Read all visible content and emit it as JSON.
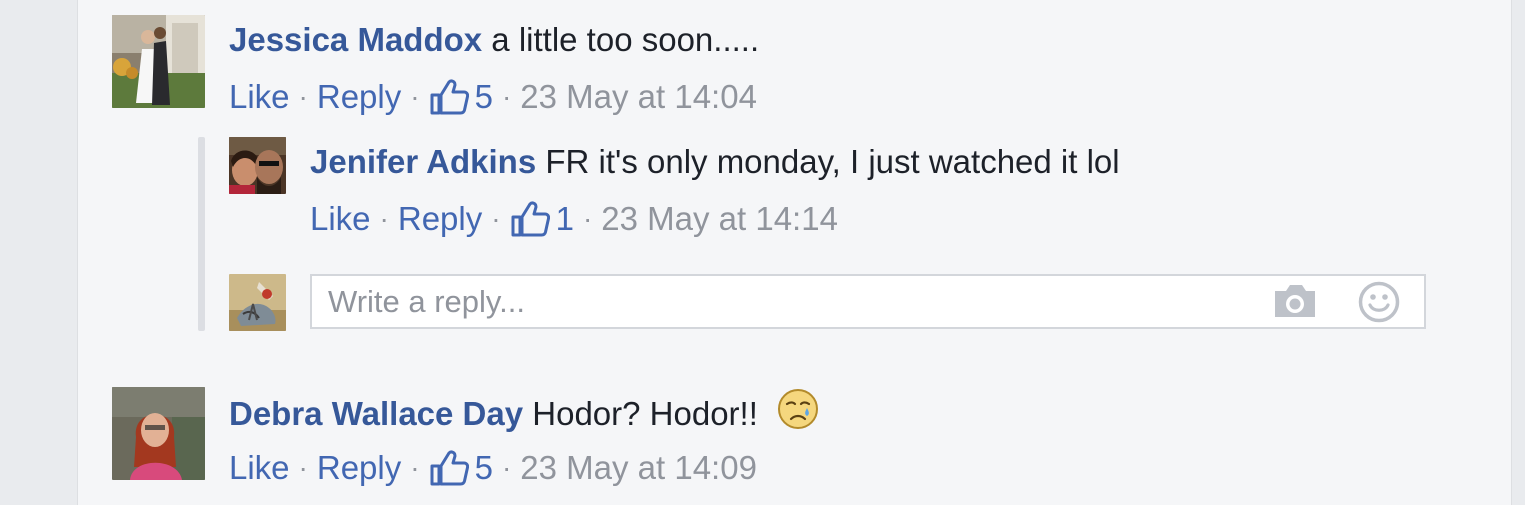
{
  "comments": [
    {
      "author": "Jessica Maddox",
      "text": "a little too soon.....",
      "like_label": "Like",
      "reply_label": "Reply",
      "like_count": "5",
      "timestamp": "23 May at 14:04",
      "replies": [
        {
          "author": "Jenifer Adkins",
          "text": "FR it's only monday, I just watched it lol",
          "like_label": "Like",
          "reply_label": "Reply",
          "like_count": "1",
          "timestamp": "23 May at 14:14"
        }
      ],
      "reply_box": {
        "placeholder": "Write a reply..."
      }
    },
    {
      "author": "Debra Wallace Day",
      "text": "Hodor? Hodor!!",
      "emoji": "crying-face",
      "like_label": "Like",
      "reply_label": "Reply",
      "like_count": "5",
      "timestamp": "23 May at 14:09"
    }
  ],
  "colors": {
    "author": "#365899",
    "link": "#4267b2",
    "muted": "#90949c",
    "panel_bg": "#f5f6f8"
  },
  "icons": {
    "like": "thumbs-up-icon",
    "camera": "camera-icon",
    "smiley": "smiley-icon"
  }
}
